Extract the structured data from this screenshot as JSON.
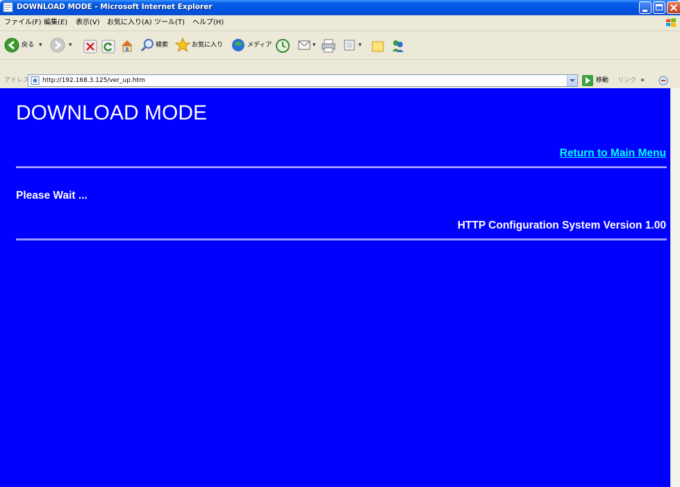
{
  "window": {
    "title": "DOWNLOAD MODE - Microsoft Internet Explorer"
  },
  "menu": {
    "items": [
      {
        "label": "ファイル(F)"
      },
      {
        "label": "編集(E)"
      },
      {
        "label": "表示(V)"
      },
      {
        "label": "お気に入り(A)"
      },
      {
        "label": "ツール(T)"
      },
      {
        "label": "ヘルプ(H)"
      }
    ]
  },
  "toolbar": {
    "back_label": "戻る",
    "search_label": "検索",
    "favorites_label": "お気に入り",
    "media_label": "メディア"
  },
  "address": {
    "label": "アドレス(D)",
    "url": "http://192.168.3.125/ver_up.htm",
    "go_label": "移動",
    "links_label": "リンク",
    "chevron": "»"
  },
  "page": {
    "heading": "DOWNLOAD MODE",
    "return_link": "Return to Main Menu",
    "wait_text": "Please Wait ...",
    "version_text": "HTTP Configuration System Version 1.00"
  },
  "colors": {
    "page_background": "#0000ff",
    "link": "#00ffff",
    "text": "#ffffff",
    "titlebar": "#0054e3"
  }
}
